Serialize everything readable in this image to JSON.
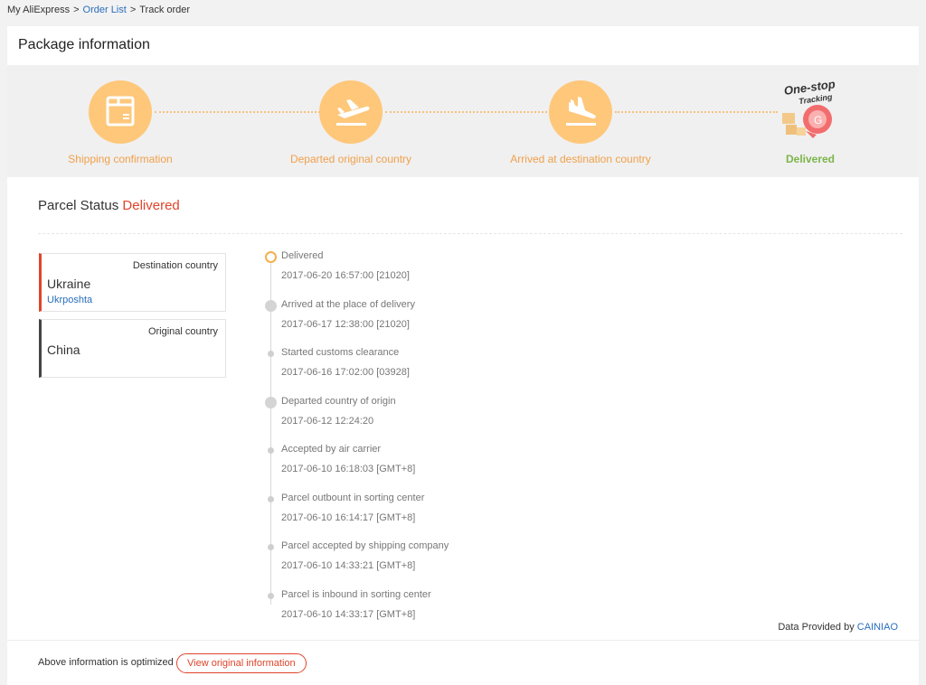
{
  "breadcrumb": {
    "home": "My AliExpress",
    "sep1": ">",
    "order_list": "Order List",
    "sep2": ">",
    "current": "Track order"
  },
  "panel": {
    "title": "Package information"
  },
  "steps": [
    {
      "label": "Shipping confirmation",
      "icon": "package-box-icon"
    },
    {
      "label": "Departed original country",
      "icon": "plane-takeoff-icon"
    },
    {
      "label": "Arrived at destination country",
      "icon": "plane-landing-icon"
    },
    {
      "label": "Delivered",
      "icon": "one-stop-tracking-logo",
      "logo_line1": "One-stop",
      "logo_line2": "Tracking"
    }
  ],
  "status": {
    "label": "Parcel Status",
    "value": "Delivered"
  },
  "destination": {
    "type": "Destination country",
    "name": "Ukraine",
    "carrier": "Ukrposhta"
  },
  "origin": {
    "type": "Original country",
    "name": "China"
  },
  "events": [
    {
      "title": "Delivered",
      "time": "2017-06-20 16:57:00 [21020]"
    },
    {
      "title": "Arrived at the place of delivery",
      "time": "2017-06-17 12:38:00 [21020]"
    },
    {
      "title": "Started customs clearance",
      "time": "2017-06-16 17:02:00 [03928]"
    },
    {
      "title": "Departed country of origin",
      "time": "2017-06-12 12:24:20"
    },
    {
      "title": "Accepted by air carrier",
      "time": "2017-06-10 16:18:03 [GMT+8]"
    },
    {
      "title": "Parcel outbount in sorting center",
      "time": "2017-06-10 16:14:17 [GMT+8]"
    },
    {
      "title": "Parcel accepted by shipping company",
      "time": "2017-06-10 14:33:21 [GMT+8]"
    },
    {
      "title": "Parcel is inbound in sorting center",
      "time": "2017-06-10 14:33:17 [GMT+8]"
    }
  ],
  "provider": {
    "label": "Data Provided by",
    "name": "CAINIAO"
  },
  "footer": {
    "note": "Above information is optimized",
    "button": "View original information"
  },
  "colors": {
    "accent_orange": "#fec77a",
    "delivered_green": "#7bb54a",
    "status_red": "#e0442a",
    "link_blue": "#2a6ebb"
  }
}
